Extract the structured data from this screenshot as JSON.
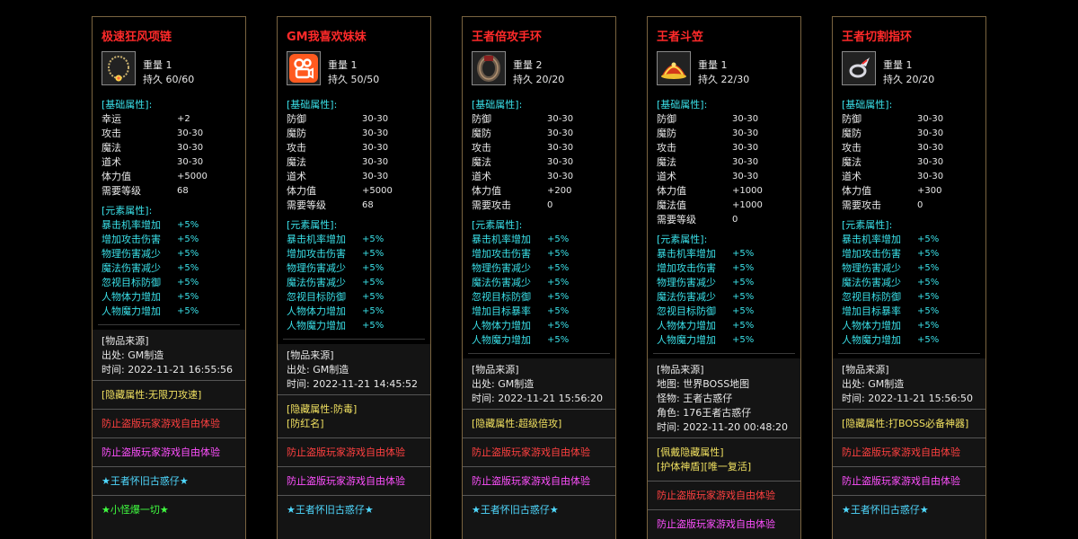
{
  "cards": [
    {
      "name": "极速狂风项链",
      "icon": "necklace-icon",
      "weight_label": "重量",
      "weight": "1",
      "durability_label": "持久",
      "durability": "60/60",
      "base_header": "[基础属性]:",
      "base": [
        {
          "label": "幸运",
          "value": "+2"
        },
        {
          "label": "攻击",
          "value": "30-30"
        },
        {
          "label": "魔法",
          "value": "30-30"
        },
        {
          "label": "道术",
          "value": "30-30"
        },
        {
          "label": "体力值",
          "value": "+5000"
        },
        {
          "label": "需要等级",
          "value": "68"
        }
      ],
      "elem_header": "[元素属性]:",
      "elem": [
        {
          "label": "暴击机率增加",
          "value": "+5%"
        },
        {
          "label": "增加攻击伤害",
          "value": "+5%"
        },
        {
          "label": "物理伤害减少",
          "value": "+5%"
        },
        {
          "label": "魔法伤害减少",
          "value": "+5%"
        },
        {
          "label": "忽视目标防御",
          "value": "+5%"
        },
        {
          "label": "人物体力增加",
          "value": "+5%"
        },
        {
          "label": "人物魔力增加",
          "value": "+5%"
        }
      ],
      "source": [
        "[物品来源]",
        "出处: GM制造",
        "时间: 2022-11-21 16:55:56"
      ],
      "extras": [
        {
          "text": "[隐藏属性:无限刀攻速]",
          "cls": "yellow"
        },
        {
          "text": "防止盗版玩家游戏自由体验",
          "cls": "red"
        },
        {
          "text": "防止盗版玩家游戏自由体验",
          "cls": "magenta"
        },
        {
          "text": "★王者怀旧古惑仔★",
          "cls": "star"
        },
        {
          "text": "★小怪爆一切★",
          "cls": "green"
        }
      ]
    },
    {
      "name": "GM我喜欢妹妹",
      "icon": "kuaishou-app-icon",
      "weight_label": "重量",
      "weight": "1",
      "durability_label": "持久",
      "durability": "50/50",
      "base_header": "[基础属性]:",
      "base": [
        {
          "label": "防御",
          "value": "30-30"
        },
        {
          "label": "魔防",
          "value": "30-30"
        },
        {
          "label": "攻击",
          "value": "30-30"
        },
        {
          "label": "魔法",
          "value": "30-30"
        },
        {
          "label": "道术",
          "value": "30-30"
        },
        {
          "label": "体力值",
          "value": "+5000"
        },
        {
          "label": "需要等级",
          "value": "68"
        }
      ],
      "elem_header": "[元素属性]:",
      "elem": [
        {
          "label": "暴击机率增加",
          "value": "+5%"
        },
        {
          "label": "增加攻击伤害",
          "value": "+5%"
        },
        {
          "label": "物理伤害减少",
          "value": "+5%"
        },
        {
          "label": "魔法伤害减少",
          "value": "+5%"
        },
        {
          "label": "忽视目标防御",
          "value": "+5%"
        },
        {
          "label": "人物体力增加",
          "value": "+5%"
        },
        {
          "label": "人物魔力增加",
          "value": "+5%"
        }
      ],
      "source": [
        "[物品来源]",
        "出处: GM制造",
        "时间: 2022-11-21 14:45:52"
      ],
      "extras": [
        {
          "text": "[隐藏属性:防毒]\n[防红名]",
          "cls": "yellow"
        },
        {
          "text": "防止盗版玩家游戏自由体验",
          "cls": "red"
        },
        {
          "text": "防止盗版玩家游戏自由体验",
          "cls": "magenta"
        },
        {
          "text": "★王者怀旧古惑仔★",
          "cls": "star"
        }
      ]
    },
    {
      "name": "王者倍攻手环",
      "icon": "bracelet-icon",
      "weight_label": "重量",
      "weight": "2",
      "durability_label": "持久",
      "durability": "20/20",
      "base_header": "[基础属性]:",
      "base": [
        {
          "label": "防御",
          "value": "30-30"
        },
        {
          "label": "魔防",
          "value": "30-30"
        },
        {
          "label": "攻击",
          "value": "30-30"
        },
        {
          "label": "魔法",
          "value": "30-30"
        },
        {
          "label": "道术",
          "value": "30-30"
        },
        {
          "label": "体力值",
          "value": "+200"
        },
        {
          "label": "需要攻击",
          "value": "0"
        }
      ],
      "elem_header": "[元素属性]:",
      "elem": [
        {
          "label": "暴击机率增加",
          "value": "+5%"
        },
        {
          "label": "增加攻击伤害",
          "value": "+5%"
        },
        {
          "label": "物理伤害减少",
          "value": "+5%"
        },
        {
          "label": "魔法伤害减少",
          "value": "+5%"
        },
        {
          "label": "忽视目标防御",
          "value": "+5%"
        },
        {
          "label": "增加目标暴率",
          "value": "+5%"
        },
        {
          "label": "人物体力增加",
          "value": "+5%"
        },
        {
          "label": "人物魔力增加",
          "value": "+5%"
        }
      ],
      "source": [
        "[物品来源]",
        "出处: GM制造",
        "时间: 2022-11-21 15:56:20"
      ],
      "extras": [
        {
          "text": "[隐藏属性:超级倍攻]",
          "cls": "yellow"
        },
        {
          "text": "防止盗版玩家游戏自由体验",
          "cls": "red"
        },
        {
          "text": "防止盗版玩家游戏自由体验",
          "cls": "magenta"
        },
        {
          "text": "★王者怀旧古惑仔★",
          "cls": "star"
        }
      ]
    },
    {
      "name": "王者斗笠",
      "icon": "helmet-icon",
      "weight_label": "重量",
      "weight": "1",
      "durability_label": "持久",
      "durability": "22/30",
      "base_header": "[基础属性]:",
      "base": [
        {
          "label": "防御",
          "value": "30-30"
        },
        {
          "label": "魔防",
          "value": "30-30"
        },
        {
          "label": "攻击",
          "value": "30-30"
        },
        {
          "label": "魔法",
          "value": "30-30"
        },
        {
          "label": "道术",
          "value": "30-30"
        },
        {
          "label": "体力值",
          "value": "+1000"
        },
        {
          "label": "魔法值",
          "value": "+1000"
        },
        {
          "label": "需要等级",
          "value": "0"
        }
      ],
      "elem_header": "[元素属性]:",
      "elem": [
        {
          "label": "暴击机率增加",
          "value": "+5%"
        },
        {
          "label": "增加攻击伤害",
          "value": "+5%"
        },
        {
          "label": "物理伤害减少",
          "value": "+5%"
        },
        {
          "label": "魔法伤害减少",
          "value": "+5%"
        },
        {
          "label": "忽视目标防御",
          "value": "+5%"
        },
        {
          "label": "人物体力增加",
          "value": "+5%"
        },
        {
          "label": "人物魔力增加",
          "value": "+5%"
        }
      ],
      "source": [
        "[物品来源]",
        "地图: 世界BOSS地图",
        "怪物: 王者古惑仔",
        "角色: 176王者古惑仔",
        "时间: 2022-11-20 00:48:20"
      ],
      "extras": [
        {
          "text": "[佩戴隐藏属性]\n[护体神盾][唯一复活]",
          "cls": "yellow"
        },
        {
          "text": "防止盗版玩家游戏自由体验",
          "cls": "red"
        },
        {
          "text": "防止盗版玩家游戏自由体验",
          "cls": "magenta"
        }
      ]
    },
    {
      "name": "王者切割指环",
      "icon": "ring-icon",
      "weight_label": "重量",
      "weight": "1",
      "durability_label": "持久",
      "durability": "20/20",
      "base_header": "[基础属性]:",
      "base": [
        {
          "label": "防御",
          "value": "30-30"
        },
        {
          "label": "魔防",
          "value": "30-30"
        },
        {
          "label": "攻击",
          "value": "30-30"
        },
        {
          "label": "魔法",
          "value": "30-30"
        },
        {
          "label": "道术",
          "value": "30-30"
        },
        {
          "label": "体力值",
          "value": "+300"
        },
        {
          "label": "需要攻击",
          "value": "0"
        }
      ],
      "elem_header": "[元素属性]:",
      "elem": [
        {
          "label": "暴击机率增加",
          "value": "+5%"
        },
        {
          "label": "增加攻击伤害",
          "value": "+5%"
        },
        {
          "label": "物理伤害减少",
          "value": "+5%"
        },
        {
          "label": "魔法伤害减少",
          "value": "+5%"
        },
        {
          "label": "忽视目标防御",
          "value": "+5%"
        },
        {
          "label": "增加目标暴率",
          "value": "+5%"
        },
        {
          "label": "人物体力增加",
          "value": "+5%"
        },
        {
          "label": "人物魔力增加",
          "value": "+5%"
        }
      ],
      "source": [
        "[物品来源]",
        "出处: GM制造",
        "时间: 2022-11-21 15:56:50"
      ],
      "extras": [
        {
          "text": "[隐藏属性:打BOSS必备神器]",
          "cls": "yellow"
        },
        {
          "text": "防止盗版玩家游戏自由体验",
          "cls": "red"
        },
        {
          "text": "防止盗版玩家游戏自由体验",
          "cls": "magenta"
        },
        {
          "text": "★王者怀旧古惑仔★",
          "cls": "star"
        }
      ]
    }
  ]
}
